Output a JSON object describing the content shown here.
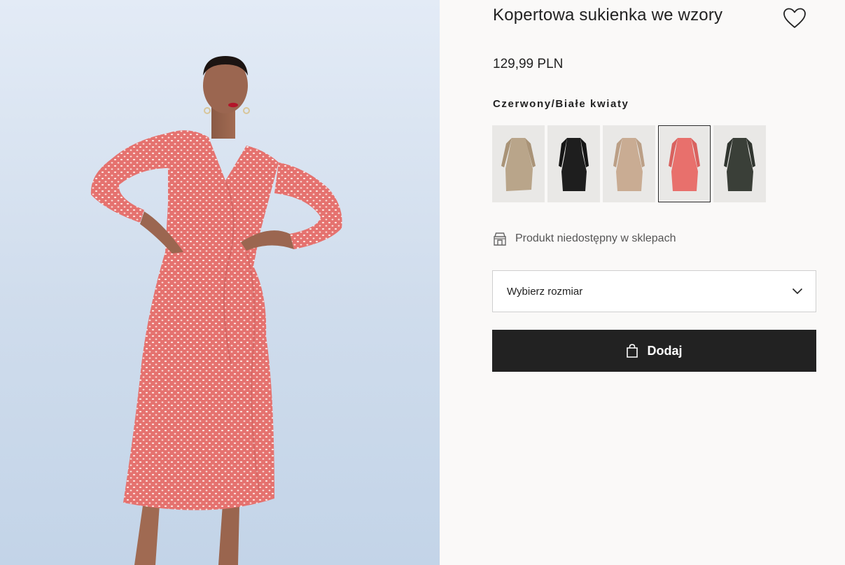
{
  "product": {
    "title": "Kopertowa sukienka we wzory",
    "price": "129,99 PLN",
    "color_name": "Czerwony/Białe kwiaty",
    "favorite_icon": "heart-icon"
  },
  "swatches": [
    {
      "name": "beige-floral",
      "color": "#b9a58a",
      "selected": false
    },
    {
      "name": "black",
      "color": "#1e1e1e",
      "selected": false
    },
    {
      "name": "beige",
      "color": "#c9ac93",
      "selected": false
    },
    {
      "name": "red-white-flowers",
      "color": "#e8706c",
      "selected": true
    },
    {
      "name": "dark-green-pattern",
      "color": "#3a3f38",
      "selected": false
    }
  ],
  "availability": {
    "icon": "store-icon",
    "text": "Produkt niedostępny w sklepach"
  },
  "size_select": {
    "label": "Wybierz rozmiar",
    "icon": "chevron-down-icon"
  },
  "add_button": {
    "label": "Dodaj",
    "icon": "shopping-bag-icon"
  },
  "colors": {
    "background": "#faf9f8",
    "button": "#222222",
    "dress": "#e5726f"
  }
}
